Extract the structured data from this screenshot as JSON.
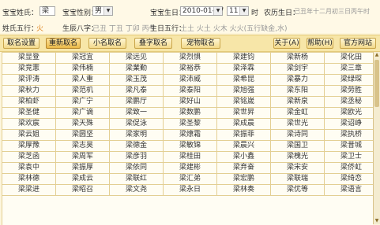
{
  "form": {
    "surname_label": "宝宝姓氏：",
    "surname_value": "梁",
    "gender_label": "宝宝性别：",
    "gender_value": "男",
    "birthday_label": "宝宝生日：",
    "birthday_value": "2010-01-17",
    "hour_value": "11",
    "hour_unit": "时",
    "lunar_label": "农历生日：",
    "lunar_value": "己丑年十二月初三日丙午时",
    "surname_wuxing_label": "姓氏五行：",
    "surname_wuxing_value": "火",
    "bazi_label": "生辰八字：",
    "bazi_value": "己丑 丁丑 丁卯 丙午",
    "birth_wuxing_label": "生日五行：",
    "birth_wuxing_value": "土土 火土 火木 火火(五行缺金,水)"
  },
  "toolbar": {
    "buttons": [
      "取名设置",
      "重新取名",
      "小名取名",
      "叠字取名",
      "宠物取名",
      "关于(A)",
      "帮助(H)",
      "官方网站"
    ]
  },
  "grid": {
    "rows": [
      [
        "梁显登",
        "梁冠宜",
        "梁远见",
        "梁烈惧",
        "梁建钧",
        "梁新杨",
        "梁化田"
      ],
      [
        "梁竞憲",
        "梁伟楠",
        "梁業勤",
        "梁裕恭",
        "梁泽霖",
        "梁剑宇",
        "梁三章"
      ],
      [
        "梁评涛",
        "梁人重",
        "梁玉茂",
        "梁沛威",
        "梁希昆",
        "梁暴力",
        "梁绿琛"
      ],
      [
        "梁秋力",
        "梁范机",
        "梁凡泰",
        "梁泰阳",
        "梁旭强",
        "梁东阳",
        "梁劳胜"
      ],
      [
        "梁柏虾",
        "梁广宁",
        "梁鹏厅",
        "梁好山",
        "梁铭嵗",
        "梁新泉",
        "梁丞秘"
      ],
      [
        "梁圣健",
        "梁广谪",
        "梁致一",
        "梁数鹏",
        "梁世昇",
        "梁金虹",
        "梁欧光"
      ],
      [
        "梁欢宸",
        "梁天殊",
        "梁促泳",
        "梁圣黎",
        "梁成晨",
        "梁世光",
        "梁诏峥"
      ],
      [
        "梁云姐",
        "梁圆坚",
        "梁家明",
        "梁燎霜",
        "梁振菲",
        "梁诗同",
        "梁执桥"
      ],
      [
        "梁厚豫",
        "梁志昊",
        "梁德金",
        "梁敏锦",
        "梁晨兴",
        "梁国卫",
        "梁昔城"
      ],
      [
        "梁芝函",
        "梁周军",
        "梁彦羽",
        "梁桂田",
        "梁小鑫",
        "梁槐光",
        "梁卫士"
      ],
      [
        "梁袁中",
        "梁振厚",
        "梁依同",
        "梁建彬",
        "梁弃奋",
        "梁宋安",
        "梁侨虹"
      ],
      [
        "梁林德",
        "梁成云",
        "梁联红",
        "梁汇弟",
        "梁宏鹏",
        "梁联瑞",
        "梁绮恋"
      ],
      [
        "梁梁进",
        "梁昭召",
        "梁文尧",
        "梁永日",
        "梁林奏",
        "梁优等",
        "梁语言"
      ]
    ]
  }
}
